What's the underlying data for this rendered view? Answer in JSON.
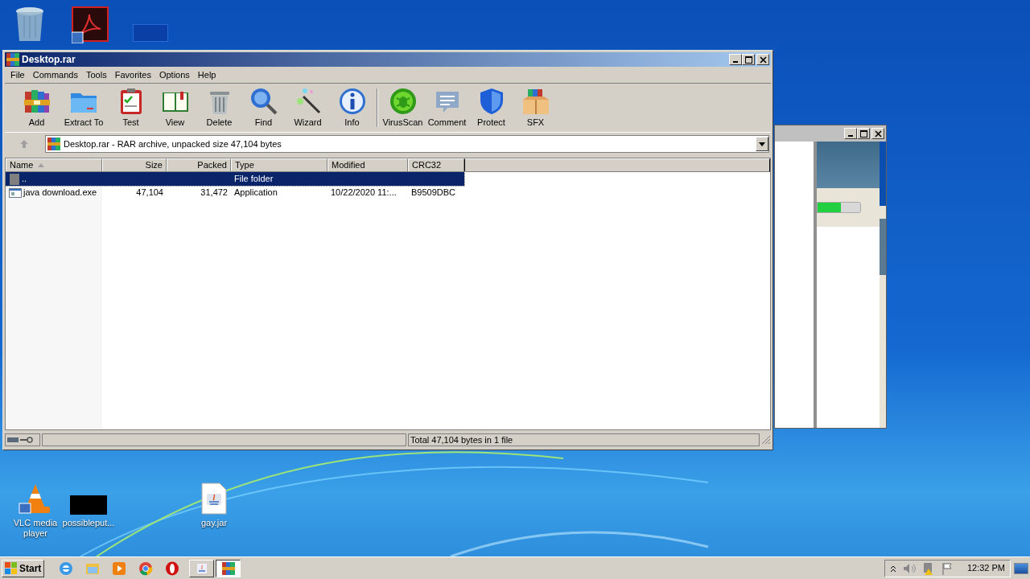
{
  "desktop_icons": [
    {
      "label": "VLC media player"
    },
    {
      "label": "possibleput..."
    },
    {
      "label": "gay.jar"
    }
  ],
  "window": {
    "title": "Desktop.rar",
    "menu": [
      "File",
      "Commands",
      "Tools",
      "Favorites",
      "Options",
      "Help"
    ],
    "toolbar": [
      {
        "label": "Add"
      },
      {
        "label": "Extract To"
      },
      {
        "label": "Test"
      },
      {
        "label": "View"
      },
      {
        "label": "Delete"
      },
      {
        "label": "Find"
      },
      {
        "label": "Wizard"
      },
      {
        "label": "Info"
      },
      {
        "label": "VirusScan"
      },
      {
        "label": "Comment"
      },
      {
        "label": "Protect"
      },
      {
        "label": "SFX"
      }
    ],
    "address": "Desktop.rar - RAR archive, unpacked size 47,104 bytes",
    "columns": [
      {
        "label": "Name",
        "sorted": true
      },
      {
        "label": "Size",
        "sorted": false
      },
      {
        "label": "Packed",
        "sorted": false
      },
      {
        "label": "Type",
        "sorted": false
      },
      {
        "label": "Modified",
        "sorted": false
      },
      {
        "label": "CRC32",
        "sorted": false
      }
    ],
    "rows": [
      {
        "kind": "folder",
        "selected": true,
        "cells": [
          "..",
          "",
          "",
          "File folder",
          "",
          ""
        ]
      },
      {
        "kind": "file",
        "selected": false,
        "cells": [
          "java download.exe",
          "47,104",
          "31,472",
          "Application",
          "10/22/2020 11:...",
          "B9509DBC"
        ]
      }
    ],
    "status": "Total 47,104 bytes in 1 file"
  },
  "background_window": {
    "progress": {
      "level": 0.55
    }
  },
  "taskbar": {
    "start": "Start",
    "tasks": [
      {
        "selected": false
      },
      {
        "selected": true
      }
    ],
    "clock": "12:32 PM"
  }
}
